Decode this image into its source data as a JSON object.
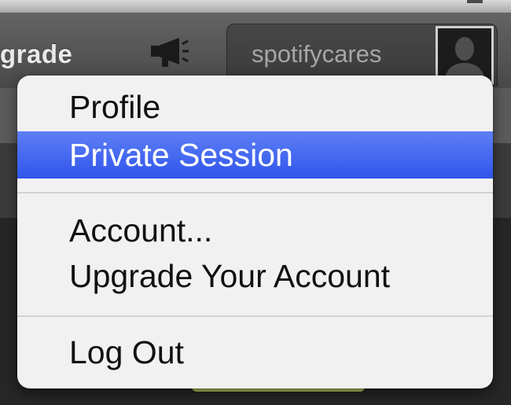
{
  "header": {
    "upgrade_label": "grade",
    "username": "spotifycares"
  },
  "menu": {
    "items": [
      {
        "label": "Profile"
      },
      {
        "label": "Private Session",
        "highlighted": true
      },
      {
        "label": "Account..."
      },
      {
        "label": "Upgrade Your Account"
      },
      {
        "label": "Log Out"
      }
    ]
  },
  "icons": {
    "announcement": "megaphone-icon",
    "avatar": "user-silhouette-icon"
  },
  "colors": {
    "highlight": "#3b5ff0",
    "menu_background": "#f1f1f1"
  }
}
